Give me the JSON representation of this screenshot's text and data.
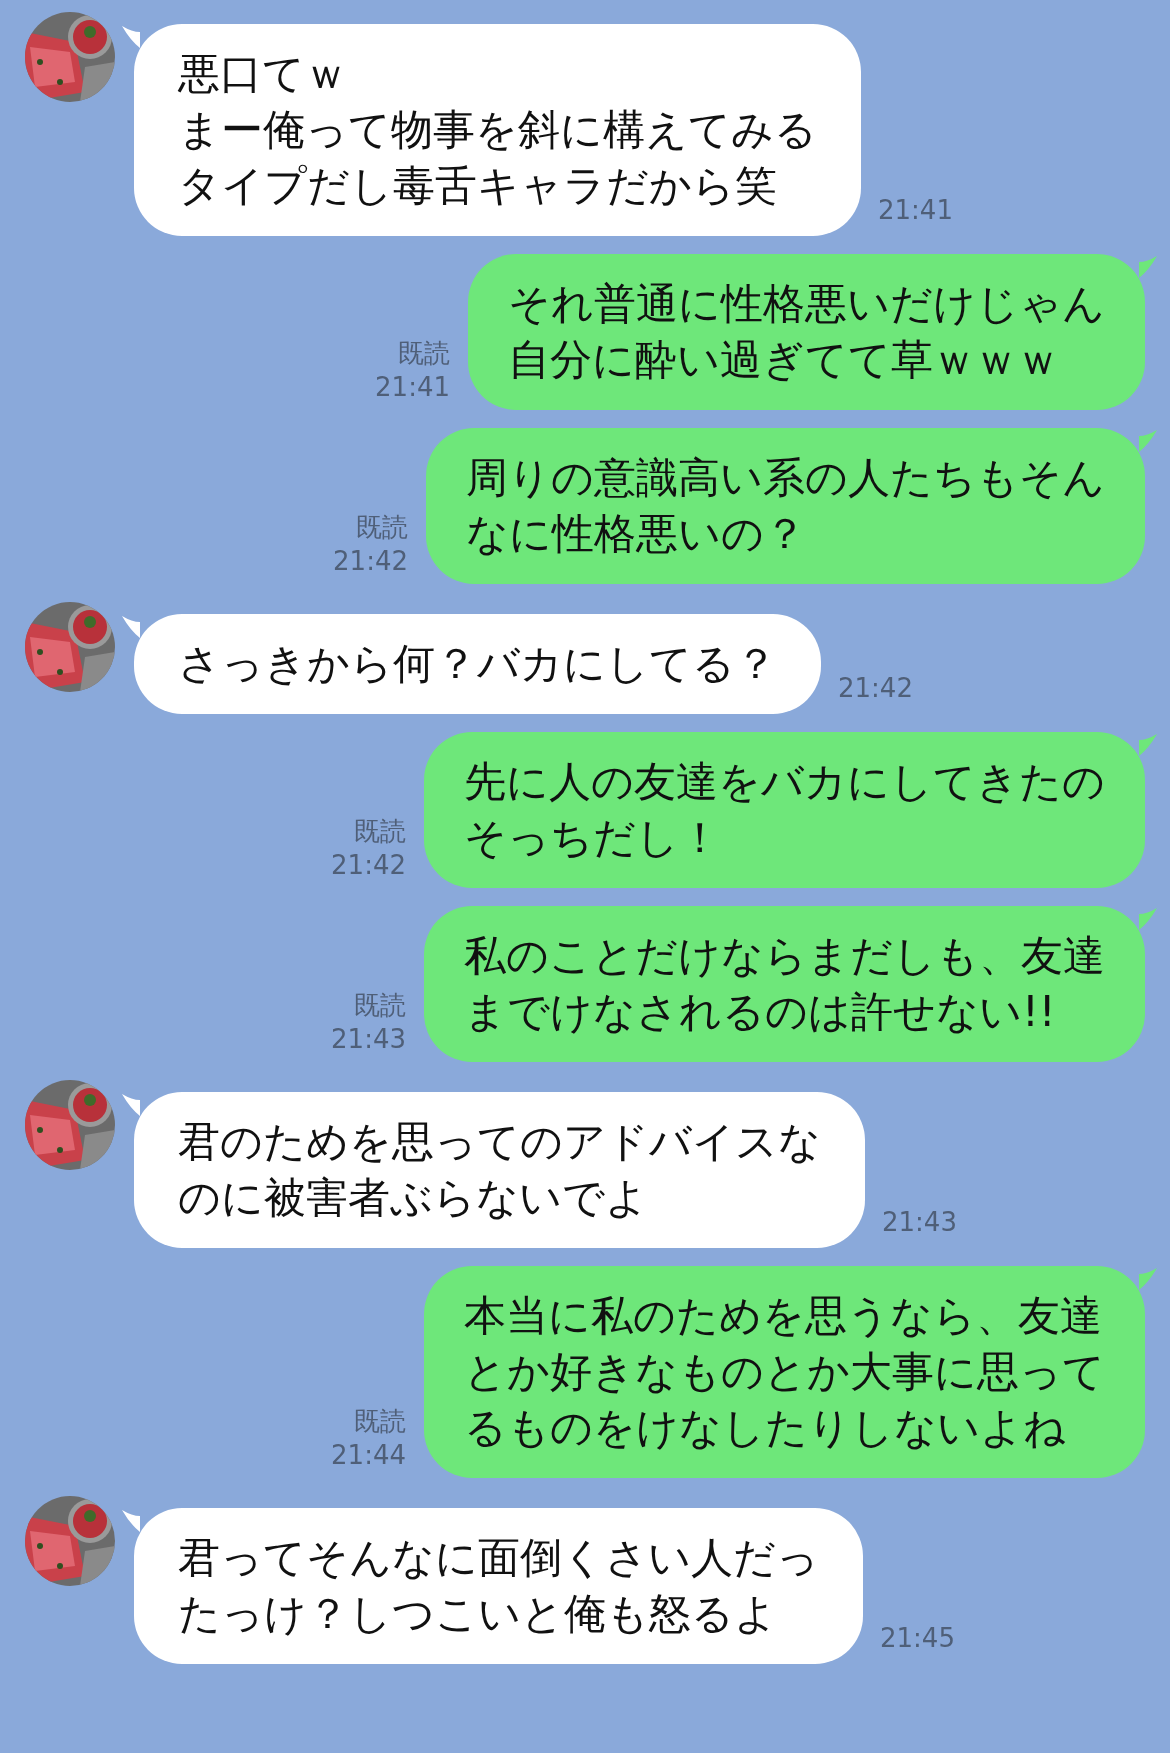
{
  "messages": [
    {
      "kind": "received",
      "lines": [
        "悪口てｗ",
        "まー俺って物事を斜に構えてみる",
        "タイプだし毒舌キャラだから笑"
      ],
      "time": "21:41"
    },
    {
      "kind": "sent",
      "lines": [
        "それ普通に性格悪いだけじゃん",
        "自分に酔い過ぎてて草ｗｗｗ"
      ],
      "read": "既読",
      "time": "21:41"
    },
    {
      "kind": "sent",
      "lines": [
        "周りの意識高い系の人たちもそん",
        "なに性格悪いの？"
      ],
      "read": "既読",
      "time": "21:42"
    },
    {
      "kind": "received",
      "lines": [
        "さっきから何？バカにしてる？"
      ],
      "time": "21:42"
    },
    {
      "kind": "sent",
      "lines": [
        "先に人の友達をバカにしてきたの",
        "そっちだし！"
      ],
      "read": "既読",
      "time": "21:42"
    },
    {
      "kind": "sent",
      "lines": [
        "私のことだけならまだしも、友達",
        "までけなされるのは許せない!!"
      ],
      "read": "既読",
      "time": "21:43"
    },
    {
      "kind": "received",
      "lines": [
        "君のためを思ってのアドバイスな",
        "のに被害者ぶらないでよ"
      ],
      "time": "21:43"
    },
    {
      "kind": "sent",
      "lines": [
        "本当に私のためを思うなら、友達",
        "とか好きなものとか大事に思って",
        "るものをけなしたりしないよね"
      ],
      "read": "既読",
      "time": "21:44"
    },
    {
      "kind": "received",
      "lines": [
        "君ってそんなに面倒くさい人だっ",
        "たっけ？しつこいと俺も怒るよ"
      ],
      "time": "21:45"
    }
  ]
}
